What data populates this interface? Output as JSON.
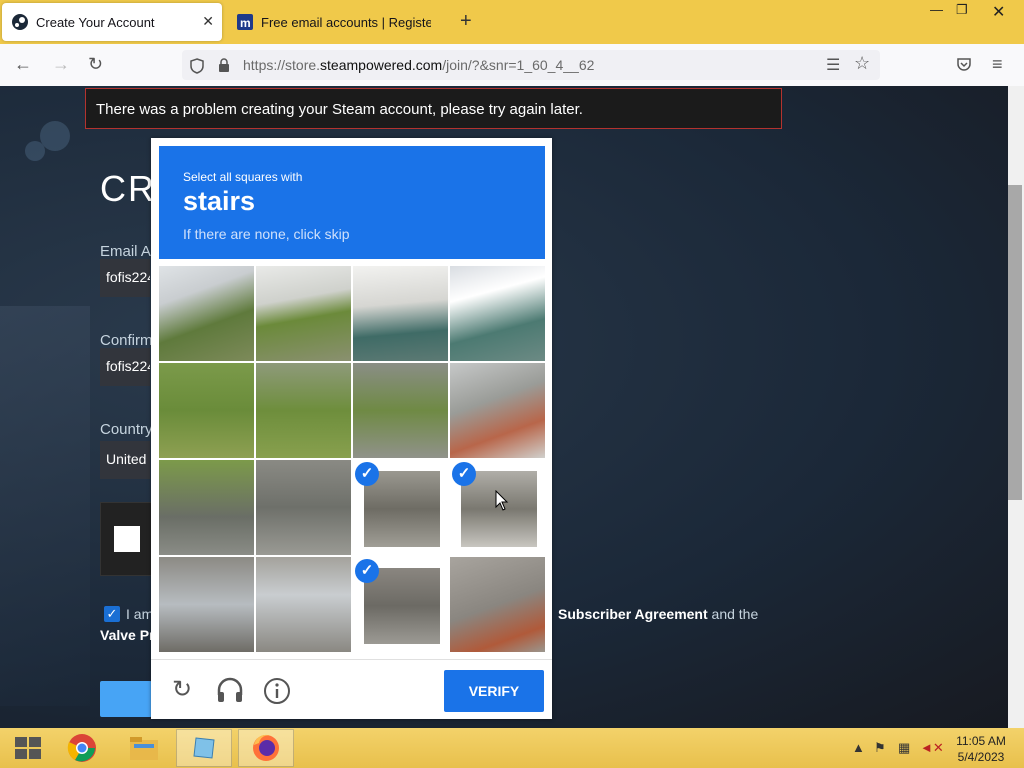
{
  "browser": {
    "tabs": [
      {
        "title": "Create Your Account",
        "active": true
      },
      {
        "title": "Free email accounts | Register to",
        "active": false
      }
    ],
    "url_prefix": "https://store.",
    "url_domain": "steampowered.com",
    "url_suffix": "/join/?&snr=1_60_4__62"
  },
  "page": {
    "error_message": "There was a problem creating your Steam account, please try again later.",
    "heading": "CRE",
    "email_label": "Email Ad",
    "email_value": "fofis224",
    "confirm_label": "Confirm",
    "confirm_value": "fofis224",
    "country_label": "Country",
    "country_value": "United",
    "agree_text": "I am",
    "agree_line2": "Valve Pr",
    "agree_right_link": "Subscriber Agreement",
    "agree_right_tail": " and the"
  },
  "captcha": {
    "instruction_small": "Select all squares with",
    "target_word": "stairs",
    "hint": "If there are none, click skip",
    "verify_label": "VERIFY",
    "selected_tiles": [
      10,
      11,
      14
    ]
  },
  "taskbar": {
    "time": "11:05 AM",
    "date": "5/4/2023"
  },
  "colors": {
    "captcha_blue": "#1a73e8",
    "error_border": "#b3332f",
    "steam_bg": "#1b2838",
    "taskbar": "#f0c94a"
  }
}
